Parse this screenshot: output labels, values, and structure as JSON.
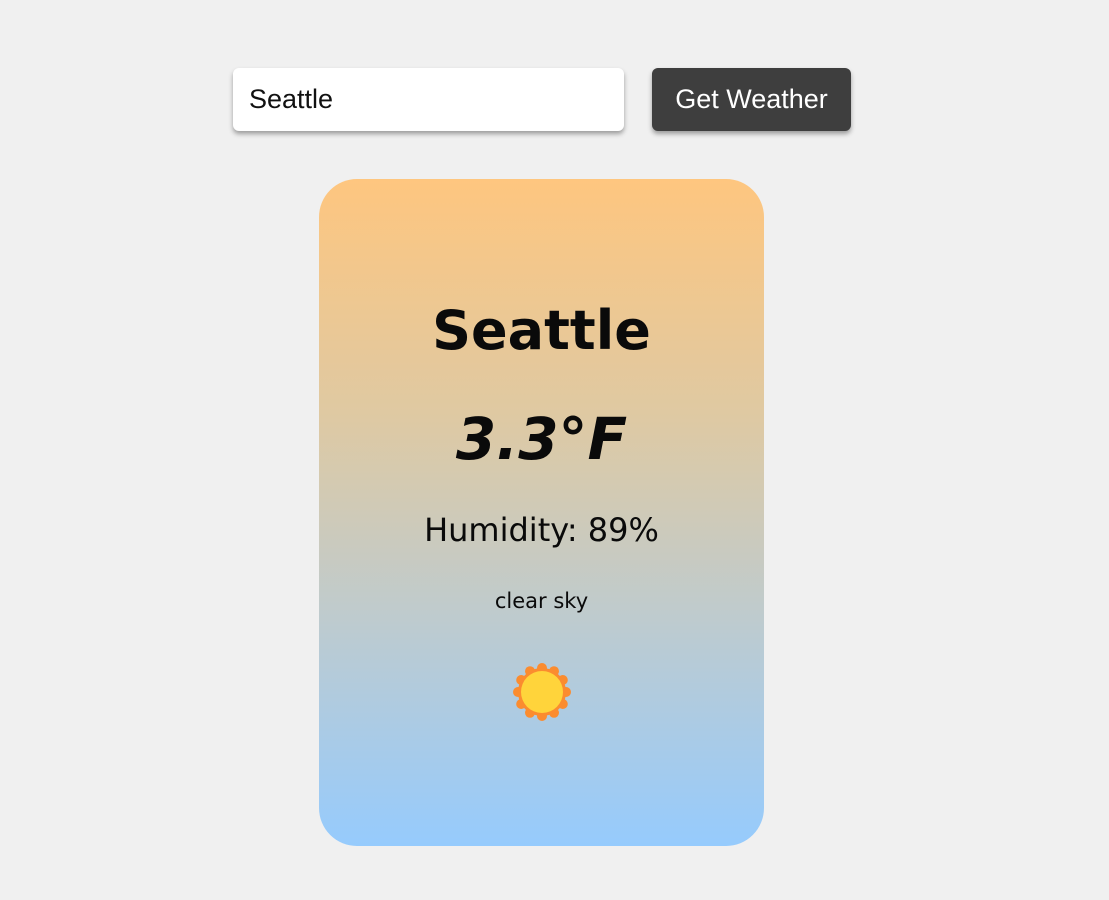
{
  "search": {
    "input_value": "Seattle",
    "button_label": "Get Weather"
  },
  "weather": {
    "city": "Seattle",
    "temperature": "3.3°F",
    "humidity": "Humidity: 89%",
    "description": "clear sky",
    "icon": "sun-icon"
  },
  "colors": {
    "page_background": "#f0f0f0",
    "button_background": "#3e3e3e",
    "card_gradient_top": "#fec67f",
    "card_gradient_bottom": "#96cbfd",
    "sun_fill": "#ffd43b",
    "sun_outline": "#fb8c2f"
  }
}
